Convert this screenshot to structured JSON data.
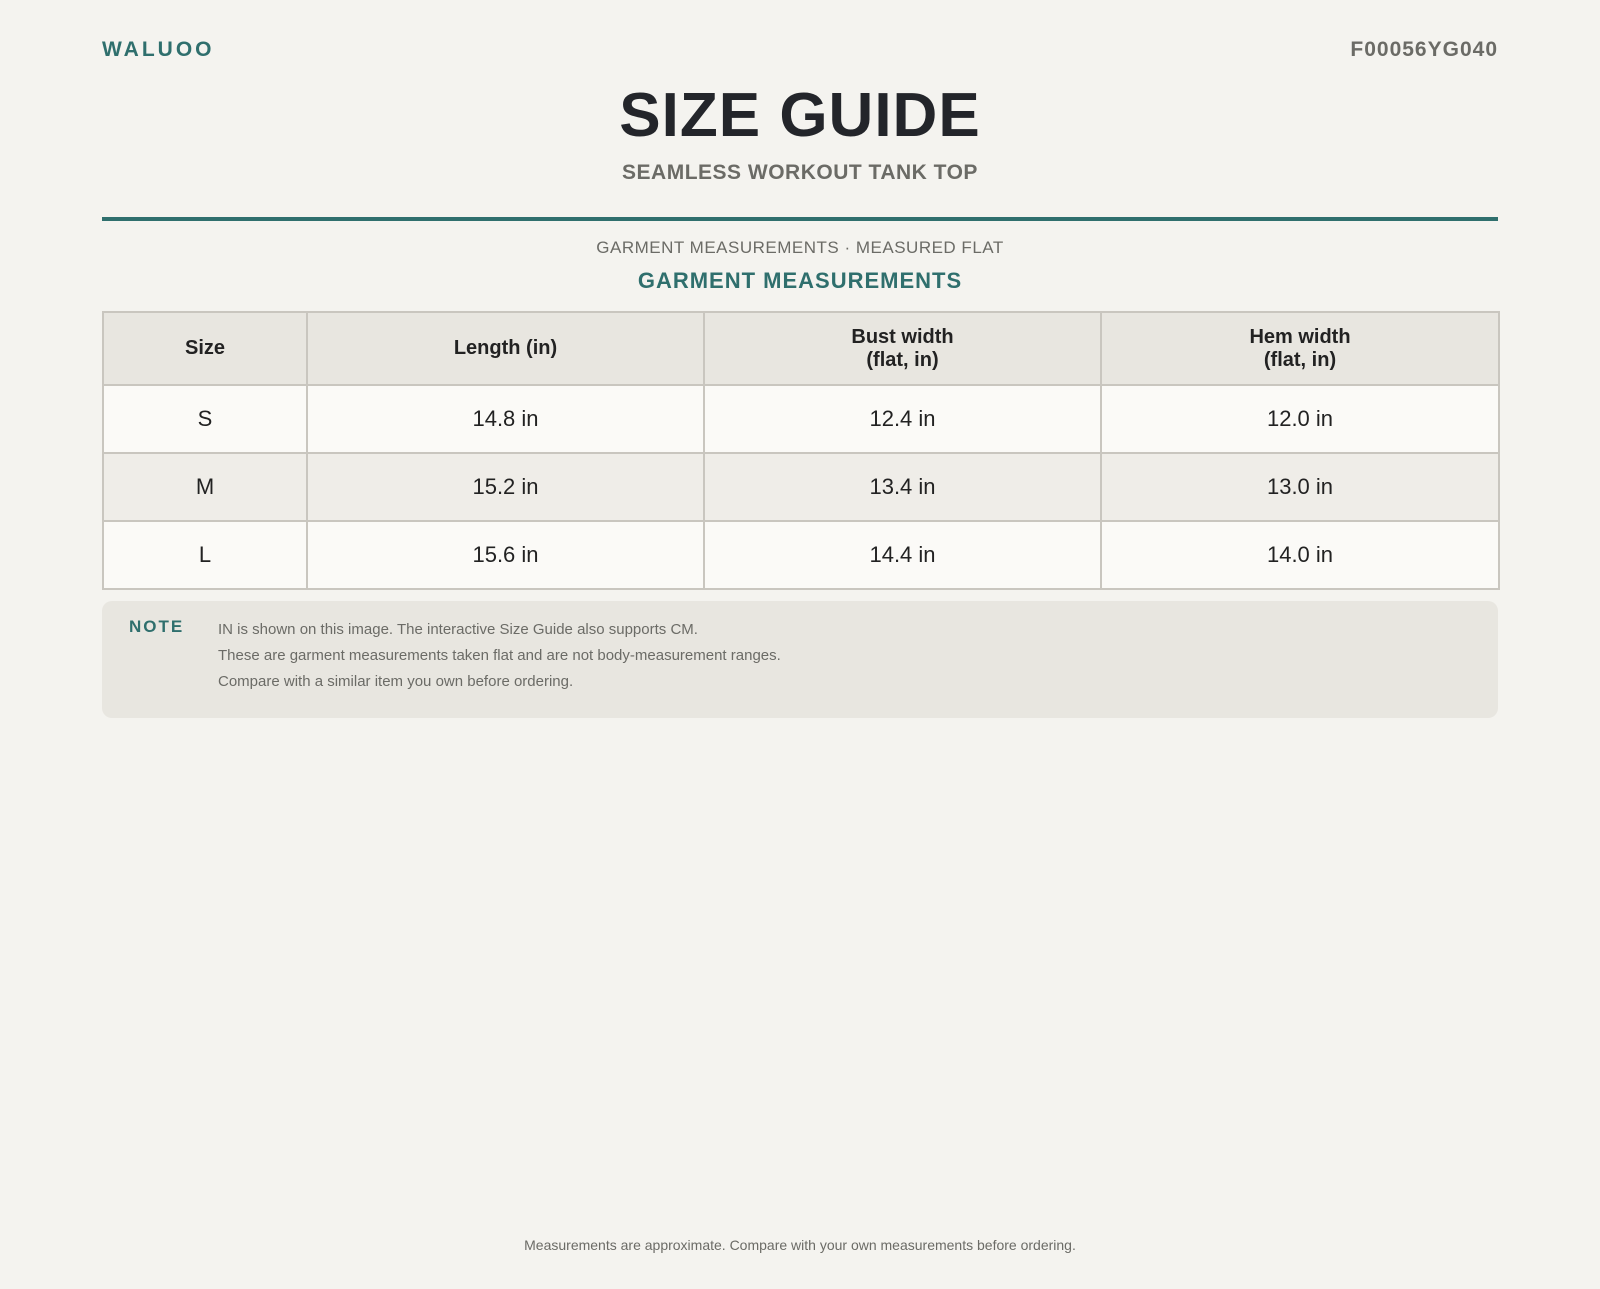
{
  "header": {
    "brand": "WALUOO",
    "product_code": "F00056YG040"
  },
  "title": "SIZE GUIDE",
  "subtitle": "SEAMLESS WORKOUT TANK TOP",
  "section": {
    "kicker": "GARMENT MEASUREMENTS · MEASURED FLAT",
    "title": "GARMENT MEASUREMENTS"
  },
  "table": {
    "headers": [
      "Size",
      "Length (in)",
      "Bust width\n(flat, in)",
      "Hem width\n(flat, in)"
    ],
    "rows": [
      [
        "S",
        "14.8 in",
        "12.4 in",
        "12.0 in"
      ],
      [
        "M",
        "15.2 in",
        "13.4 in",
        "13.0 in"
      ],
      [
        "L",
        "15.6 in",
        "14.4 in",
        "14.0 in"
      ]
    ]
  },
  "note": {
    "label": "NOTE",
    "lines": [
      "IN is shown on this image. The interactive Size Guide also supports CM.",
      "These are garment measurements taken flat and are not body-measurement ranges.",
      "Compare with a similar item you own before ordering."
    ]
  },
  "footer": "Measurements are approximate. Compare with your own measurements before ordering.",
  "colors": {
    "accent": "#2f6f6d",
    "background": "#f4f3ef",
    "muted_text": "#6b6b66",
    "header_fill": "#e8e6e0"
  }
}
